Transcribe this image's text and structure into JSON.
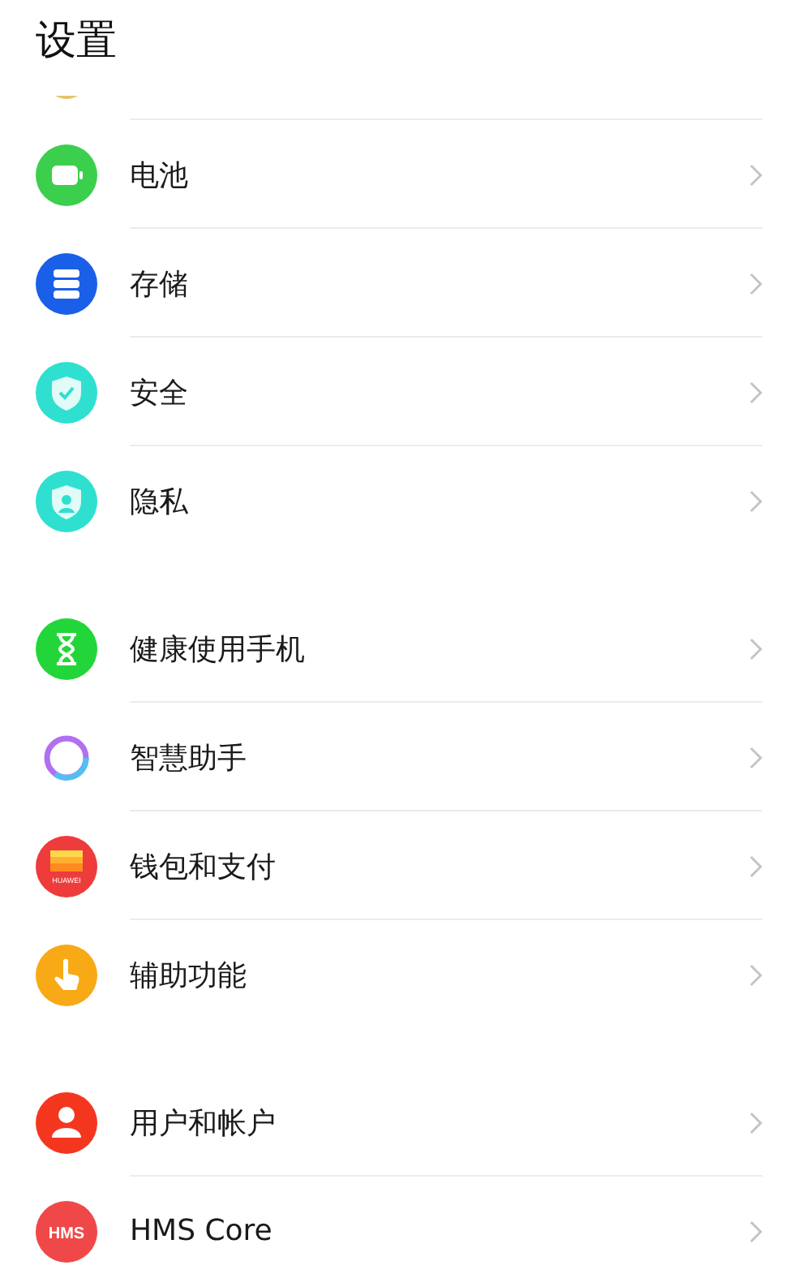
{
  "title": "设置",
  "groups": [
    {
      "items": [
        {
          "label": "电池",
          "kind": "battery",
          "color": "#3ccf4e"
        },
        {
          "label": "存储",
          "kind": "storage",
          "color": "#1a5fe8"
        },
        {
          "label": "安全",
          "kind": "shield-check",
          "color": "#2fe0d0"
        },
        {
          "label": "隐私",
          "kind": "shield-person",
          "color": "#2fe0d0"
        }
      ]
    },
    {
      "items": [
        {
          "label": "健康使用手机",
          "kind": "hourglass",
          "color": "#22d63a"
        },
        {
          "label": "智慧助手",
          "kind": "ring",
          "color": "#b070f0"
        },
        {
          "label": "钱包和支付",
          "kind": "wallet",
          "color": "#ee3b3b",
          "icon_text": "HUAWEI"
        },
        {
          "label": "辅助功能",
          "kind": "hand",
          "color": "#f7a916"
        }
      ]
    },
    {
      "items": [
        {
          "label": "用户和帐户",
          "kind": "person",
          "color": "#f5361f"
        },
        {
          "label": "HMS Core",
          "kind": "badge",
          "color": "#f04848",
          "icon_text": "HMS"
        }
      ]
    }
  ]
}
